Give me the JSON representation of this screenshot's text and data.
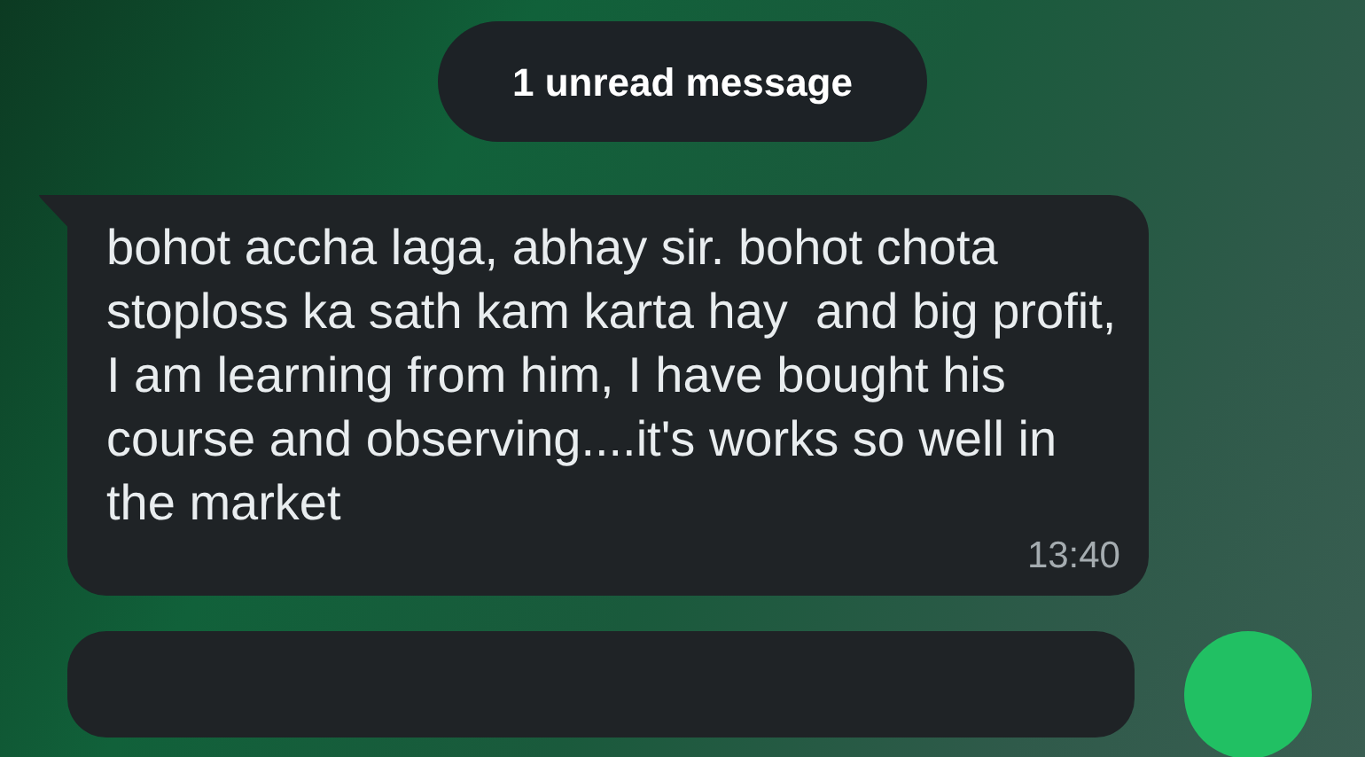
{
  "unread_banner": {
    "text": "1 unread message"
  },
  "messages": [
    {
      "text": "bohot accha laga, abhay sir. bohot chota stoploss ka sath kam karta hay  and big profit, I am learning from him, I have bought his course and observing....it's works so well in the market",
      "time": "13:40"
    }
  ]
}
